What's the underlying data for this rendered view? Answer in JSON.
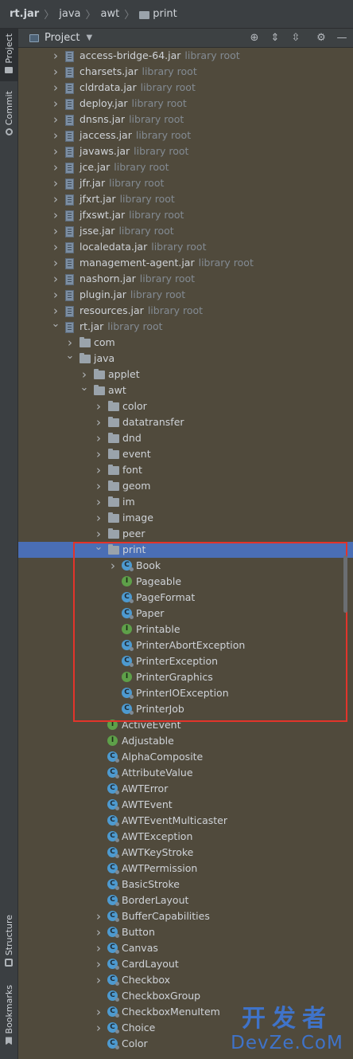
{
  "breadcrumb": [
    "rt.jar",
    "java",
    "awt",
    "print"
  ],
  "left_toolbar": {
    "project": "Project",
    "commit": "Commit",
    "structure": "Structure",
    "bookmarks": "Bookmarks"
  },
  "panel": {
    "title": "Project"
  },
  "tree": [
    {
      "indent": 0,
      "chev": "collapsed",
      "icon": "jar",
      "label": "access-bridge-64.jar",
      "hint": "library root"
    },
    {
      "indent": 0,
      "chev": "collapsed",
      "icon": "jar",
      "label": "charsets.jar",
      "hint": "library root"
    },
    {
      "indent": 0,
      "chev": "collapsed",
      "icon": "jar",
      "label": "cldrdata.jar",
      "hint": "library root"
    },
    {
      "indent": 0,
      "chev": "collapsed",
      "icon": "jar",
      "label": "deploy.jar",
      "hint": "library root"
    },
    {
      "indent": 0,
      "chev": "collapsed",
      "icon": "jar",
      "label": "dnsns.jar",
      "hint": "library root"
    },
    {
      "indent": 0,
      "chev": "collapsed",
      "icon": "jar",
      "label": "jaccess.jar",
      "hint": "library root"
    },
    {
      "indent": 0,
      "chev": "collapsed",
      "icon": "jar",
      "label": "javaws.jar",
      "hint": "library root"
    },
    {
      "indent": 0,
      "chev": "collapsed",
      "icon": "jar",
      "label": "jce.jar",
      "hint": "library root"
    },
    {
      "indent": 0,
      "chev": "collapsed",
      "icon": "jar",
      "label": "jfr.jar",
      "hint": "library root"
    },
    {
      "indent": 0,
      "chev": "collapsed",
      "icon": "jar",
      "label": "jfxrt.jar",
      "hint": "library root"
    },
    {
      "indent": 0,
      "chev": "collapsed",
      "icon": "jar",
      "label": "jfxswt.jar",
      "hint": "library root"
    },
    {
      "indent": 0,
      "chev": "collapsed",
      "icon": "jar",
      "label": "jsse.jar",
      "hint": "library root"
    },
    {
      "indent": 0,
      "chev": "collapsed",
      "icon": "jar",
      "label": "localedata.jar",
      "hint": "library root"
    },
    {
      "indent": 0,
      "chev": "collapsed",
      "icon": "jar",
      "label": "management-agent.jar",
      "hint": "library root"
    },
    {
      "indent": 0,
      "chev": "collapsed",
      "icon": "jar",
      "label": "nashorn.jar",
      "hint": "library root"
    },
    {
      "indent": 0,
      "chev": "collapsed",
      "icon": "jar",
      "label": "plugin.jar",
      "hint": "library root"
    },
    {
      "indent": 0,
      "chev": "collapsed",
      "icon": "jar",
      "label": "resources.jar",
      "hint": "library root"
    },
    {
      "indent": 0,
      "chev": "expanded",
      "icon": "jar",
      "label": "rt.jar",
      "hint": "library root"
    },
    {
      "indent": 1,
      "chev": "collapsed",
      "icon": "folder",
      "label": "com"
    },
    {
      "indent": 1,
      "chev": "expanded",
      "icon": "folder",
      "label": "java"
    },
    {
      "indent": 2,
      "chev": "collapsed",
      "icon": "folder",
      "label": "applet"
    },
    {
      "indent": 2,
      "chev": "expanded",
      "icon": "folder",
      "label": "awt"
    },
    {
      "indent": 3,
      "chev": "collapsed",
      "icon": "folder",
      "label": "color"
    },
    {
      "indent": 3,
      "chev": "collapsed",
      "icon": "folder",
      "label": "datatransfer"
    },
    {
      "indent": 3,
      "chev": "collapsed",
      "icon": "folder",
      "label": "dnd"
    },
    {
      "indent": 3,
      "chev": "collapsed",
      "icon": "folder",
      "label": "event"
    },
    {
      "indent": 3,
      "chev": "collapsed",
      "icon": "folder",
      "label": "font"
    },
    {
      "indent": 3,
      "chev": "collapsed",
      "icon": "folder",
      "label": "geom"
    },
    {
      "indent": 3,
      "chev": "collapsed",
      "icon": "folder",
      "label": "im"
    },
    {
      "indent": 3,
      "chev": "collapsed",
      "icon": "folder",
      "label": "image"
    },
    {
      "indent": 3,
      "chev": "collapsed",
      "icon": "folder",
      "label": "peer"
    },
    {
      "indent": 3,
      "chev": "expanded",
      "icon": "folder",
      "label": "print",
      "selected": true
    },
    {
      "indent": 4,
      "chev": "collapsed",
      "icon": "class",
      "label": "Book"
    },
    {
      "indent": 4,
      "chev": "none",
      "icon": "iface",
      "label": "Pageable"
    },
    {
      "indent": 4,
      "chev": "none",
      "icon": "class",
      "label": "PageFormat"
    },
    {
      "indent": 4,
      "chev": "none",
      "icon": "class",
      "label": "Paper"
    },
    {
      "indent": 4,
      "chev": "none",
      "icon": "iface",
      "label": "Printable"
    },
    {
      "indent": 4,
      "chev": "none",
      "icon": "class",
      "label": "PrinterAbortException"
    },
    {
      "indent": 4,
      "chev": "none",
      "icon": "class",
      "label": "PrinterException"
    },
    {
      "indent": 4,
      "chev": "none",
      "icon": "iface",
      "label": "PrinterGraphics"
    },
    {
      "indent": 4,
      "chev": "none",
      "icon": "class",
      "label": "PrinterIOException"
    },
    {
      "indent": 4,
      "chev": "none",
      "icon": "class",
      "label": "PrinterJob"
    },
    {
      "indent": 3,
      "chev": "none",
      "icon": "iface",
      "label": "ActiveEvent"
    },
    {
      "indent": 3,
      "chev": "none",
      "icon": "iface",
      "label": "Adjustable"
    },
    {
      "indent": 3,
      "chev": "none",
      "icon": "class",
      "label": "AlphaComposite"
    },
    {
      "indent": 3,
      "chev": "none",
      "icon": "class",
      "label": "AttributeValue"
    },
    {
      "indent": 3,
      "chev": "none",
      "icon": "class",
      "label": "AWTError"
    },
    {
      "indent": 3,
      "chev": "none",
      "icon": "class",
      "label": "AWTEvent"
    },
    {
      "indent": 3,
      "chev": "none",
      "icon": "class",
      "label": "AWTEventMulticaster"
    },
    {
      "indent": 3,
      "chev": "none",
      "icon": "class",
      "label": "AWTException"
    },
    {
      "indent": 3,
      "chev": "none",
      "icon": "class",
      "label": "AWTKeyStroke"
    },
    {
      "indent": 3,
      "chev": "none",
      "icon": "class",
      "label": "AWTPermission"
    },
    {
      "indent": 3,
      "chev": "none",
      "icon": "class",
      "label": "BasicStroke"
    },
    {
      "indent": 3,
      "chev": "none",
      "icon": "class",
      "label": "BorderLayout"
    },
    {
      "indent": 3,
      "chev": "collapsed",
      "icon": "class",
      "label": "BufferCapabilities"
    },
    {
      "indent": 3,
      "chev": "collapsed",
      "icon": "class",
      "label": "Button"
    },
    {
      "indent": 3,
      "chev": "collapsed",
      "icon": "class",
      "label": "Canvas"
    },
    {
      "indent": 3,
      "chev": "collapsed",
      "icon": "class",
      "label": "CardLayout"
    },
    {
      "indent": 3,
      "chev": "collapsed",
      "icon": "class",
      "label": "Checkbox"
    },
    {
      "indent": 3,
      "chev": "none",
      "icon": "class",
      "label": "CheckboxGroup"
    },
    {
      "indent": 3,
      "chev": "collapsed",
      "icon": "class",
      "label": "CheckboxMenuItem"
    },
    {
      "indent": 3,
      "chev": "collapsed",
      "icon": "class",
      "label": "Choice"
    },
    {
      "indent": 3,
      "chev": "none",
      "icon": "class",
      "label": "Color"
    }
  ],
  "watermark": {
    "top": "开发者",
    "bottom": "DevZe.CoM"
  }
}
